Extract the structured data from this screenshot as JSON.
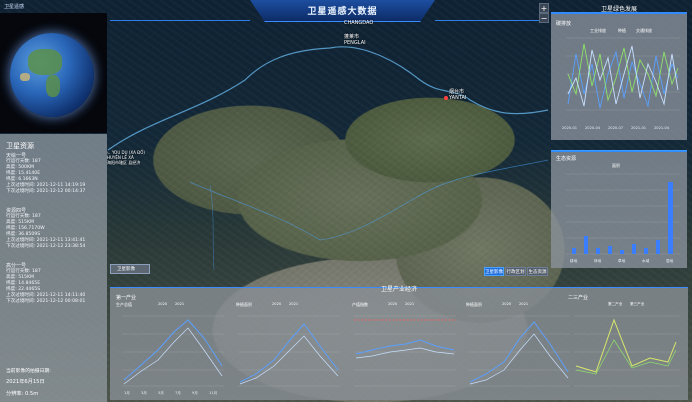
{
  "header": {
    "title": "卫星遥感大数据",
    "top_left_link": "卫星遥感"
  },
  "map": {
    "labels": {
      "changdao": "CHANGDAO",
      "penglai_cn": "蓬莱市",
      "penglai_en": "PENGLAI",
      "yantai_cn": "烟台市",
      "yantai_en": "YANTAI",
      "county_1": "ㄴ YOU DU (XA ĐỒ)",
      "county_2": "HUYỆN LẾ XÃ",
      "county_3": "海阳市辖区 县经济"
    },
    "zoom_in": "+",
    "zoom_out": "−",
    "layer_select": "卫星影像",
    "tabs": [
      "卫星影像",
      "行政区划",
      "生态资源"
    ]
  },
  "left_panel": {
    "title": "卫星资源",
    "satellites": [
      {
        "name": "天绘一号",
        "lines": [
          "行运行天数: 187",
          "高度: 500KM",
          "纬度: 15.4140E",
          "纬度: 6.1663N",
          "上次过境时间: 2021-12-11 14:19:19",
          "下次过境时间: 2021-12-12 00:14:37"
        ]
      },
      {
        "name": "资源四号",
        "lines": [
          "行运行天数: 187",
          "高度: 515KM",
          "纬度: 156.7170W",
          "纬度: 36.8509S",
          "上次过境时间: 2021-12-11 13:41:41",
          "下次过境时间: 2021-12-12 23:38:54"
        ]
      },
      {
        "name": "高分一号",
        "lines": [
          "行运行天数: 187",
          "高度: 515KM",
          "纬度: 14.8465E",
          "纬度: 22.4465S",
          "上次过境时间: 2021-12-11 14:11:40",
          "下次过境时间: 2021-12-12 00:08:01"
        ]
      }
    ],
    "footer": {
      "latest_label": "当前影像的拍摄日期:",
      "date": "2021年6月15日",
      "resolution": "分辨率: 0.5m"
    }
  },
  "right_top": {
    "title": "卫星绿色发展",
    "subtitle": "碳排放",
    "legend": [
      "工业排放",
      "种植",
      "交通排放"
    ],
    "xticks": [
      "2020-01",
      "2020-04",
      "2020-07",
      "2021-01",
      "2021-04"
    ],
    "yticks": [
      "100",
      "80",
      "60",
      "40",
      "20",
      "0"
    ]
  },
  "right_bottom": {
    "subtitle": "生态资源",
    "legend": "面积",
    "xticks": [
      "耕地",
      "林地",
      "草地",
      "水域",
      "湿地"
    ],
    "yticks": [
      "5",
      "4",
      "3",
      "2",
      "1",
      "0"
    ]
  },
  "bottom": {
    "title": "卫星产业经济",
    "charts": [
      {
        "title": "第一产业",
        "sub": "生产总值",
        "legend": [
          "2020",
          "2021"
        ]
      },
      {
        "title": "",
        "sub": "种植面积",
        "legend": [
          "2020",
          "2021"
        ]
      },
      {
        "title": "",
        "sub": "产值指数",
        "legend": [
          "2020",
          "2021"
        ]
      },
      {
        "title": "",
        "sub": "种植面积",
        "legend": [
          "2020",
          "2021"
        ]
      },
      {
        "title": "二三产业",
        "sub": "",
        "legend": [
          "第二产业",
          "第三产业"
        ]
      }
    ],
    "xticks": [
      "1月",
      "3月",
      "5月",
      "7月",
      "9月",
      "11月"
    ]
  },
  "colors": {
    "accent": "#2f8bff",
    "series_a": "#5aa0ff",
    "series_b": "#8ee06a",
    "series_c": "#c8e0ff"
  },
  "icons": [
    "globe-icon",
    "city-marker-icon"
  ]
}
